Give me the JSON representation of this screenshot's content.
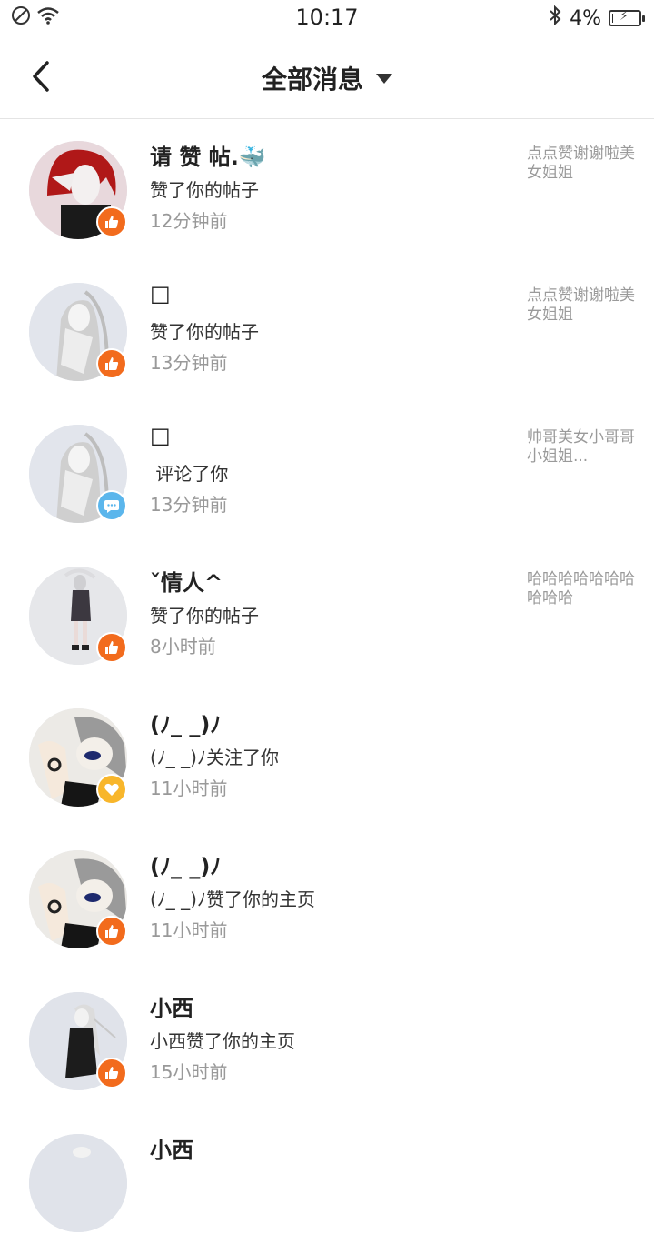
{
  "status_bar": {
    "time": "10:17",
    "battery": "4%",
    "battery_level": 0.04
  },
  "header": {
    "title": "全部消息"
  },
  "messages": [
    {
      "name": "请 赞 帖.🐳",
      "action": "赞了你的帖子",
      "time": "12分钟前",
      "preview": "点点赞谢谢啦美女姐姐",
      "badge": "like"
    },
    {
      "name": "□",
      "action": "赞了你的帖子",
      "time": "13分钟前",
      "preview": "点点赞谢谢啦美女姐姐",
      "badge": "like"
    },
    {
      "name": "□",
      "action": " 评论了你",
      "time": "13分钟前",
      "preview": "帅哥美女小哥哥小姐姐...",
      "badge": "comment"
    },
    {
      "name": "ˇ情人^",
      "action": "赞了你的帖子",
      "time": "8小时前",
      "preview": "哈哈哈哈哈哈哈哈哈哈",
      "badge": "like"
    },
    {
      "name": "(ﾉ_ _)ﾉ",
      "action": "(ﾉ_ _)ﾉ关注了你",
      "time": "11小时前",
      "preview": "",
      "badge": "follow"
    },
    {
      "name": "(ﾉ_ _)ﾉ",
      "action": "(ﾉ_ _)ﾉ赞了你的主页",
      "time": "11小时前",
      "preview": "",
      "badge": "like"
    },
    {
      "name": "小西",
      "action": "小西赞了你的主页",
      "time": "15小时前",
      "preview": "",
      "badge": "like"
    },
    {
      "name": "小西",
      "action": "",
      "time": "",
      "preview": "",
      "badge": ""
    }
  ]
}
